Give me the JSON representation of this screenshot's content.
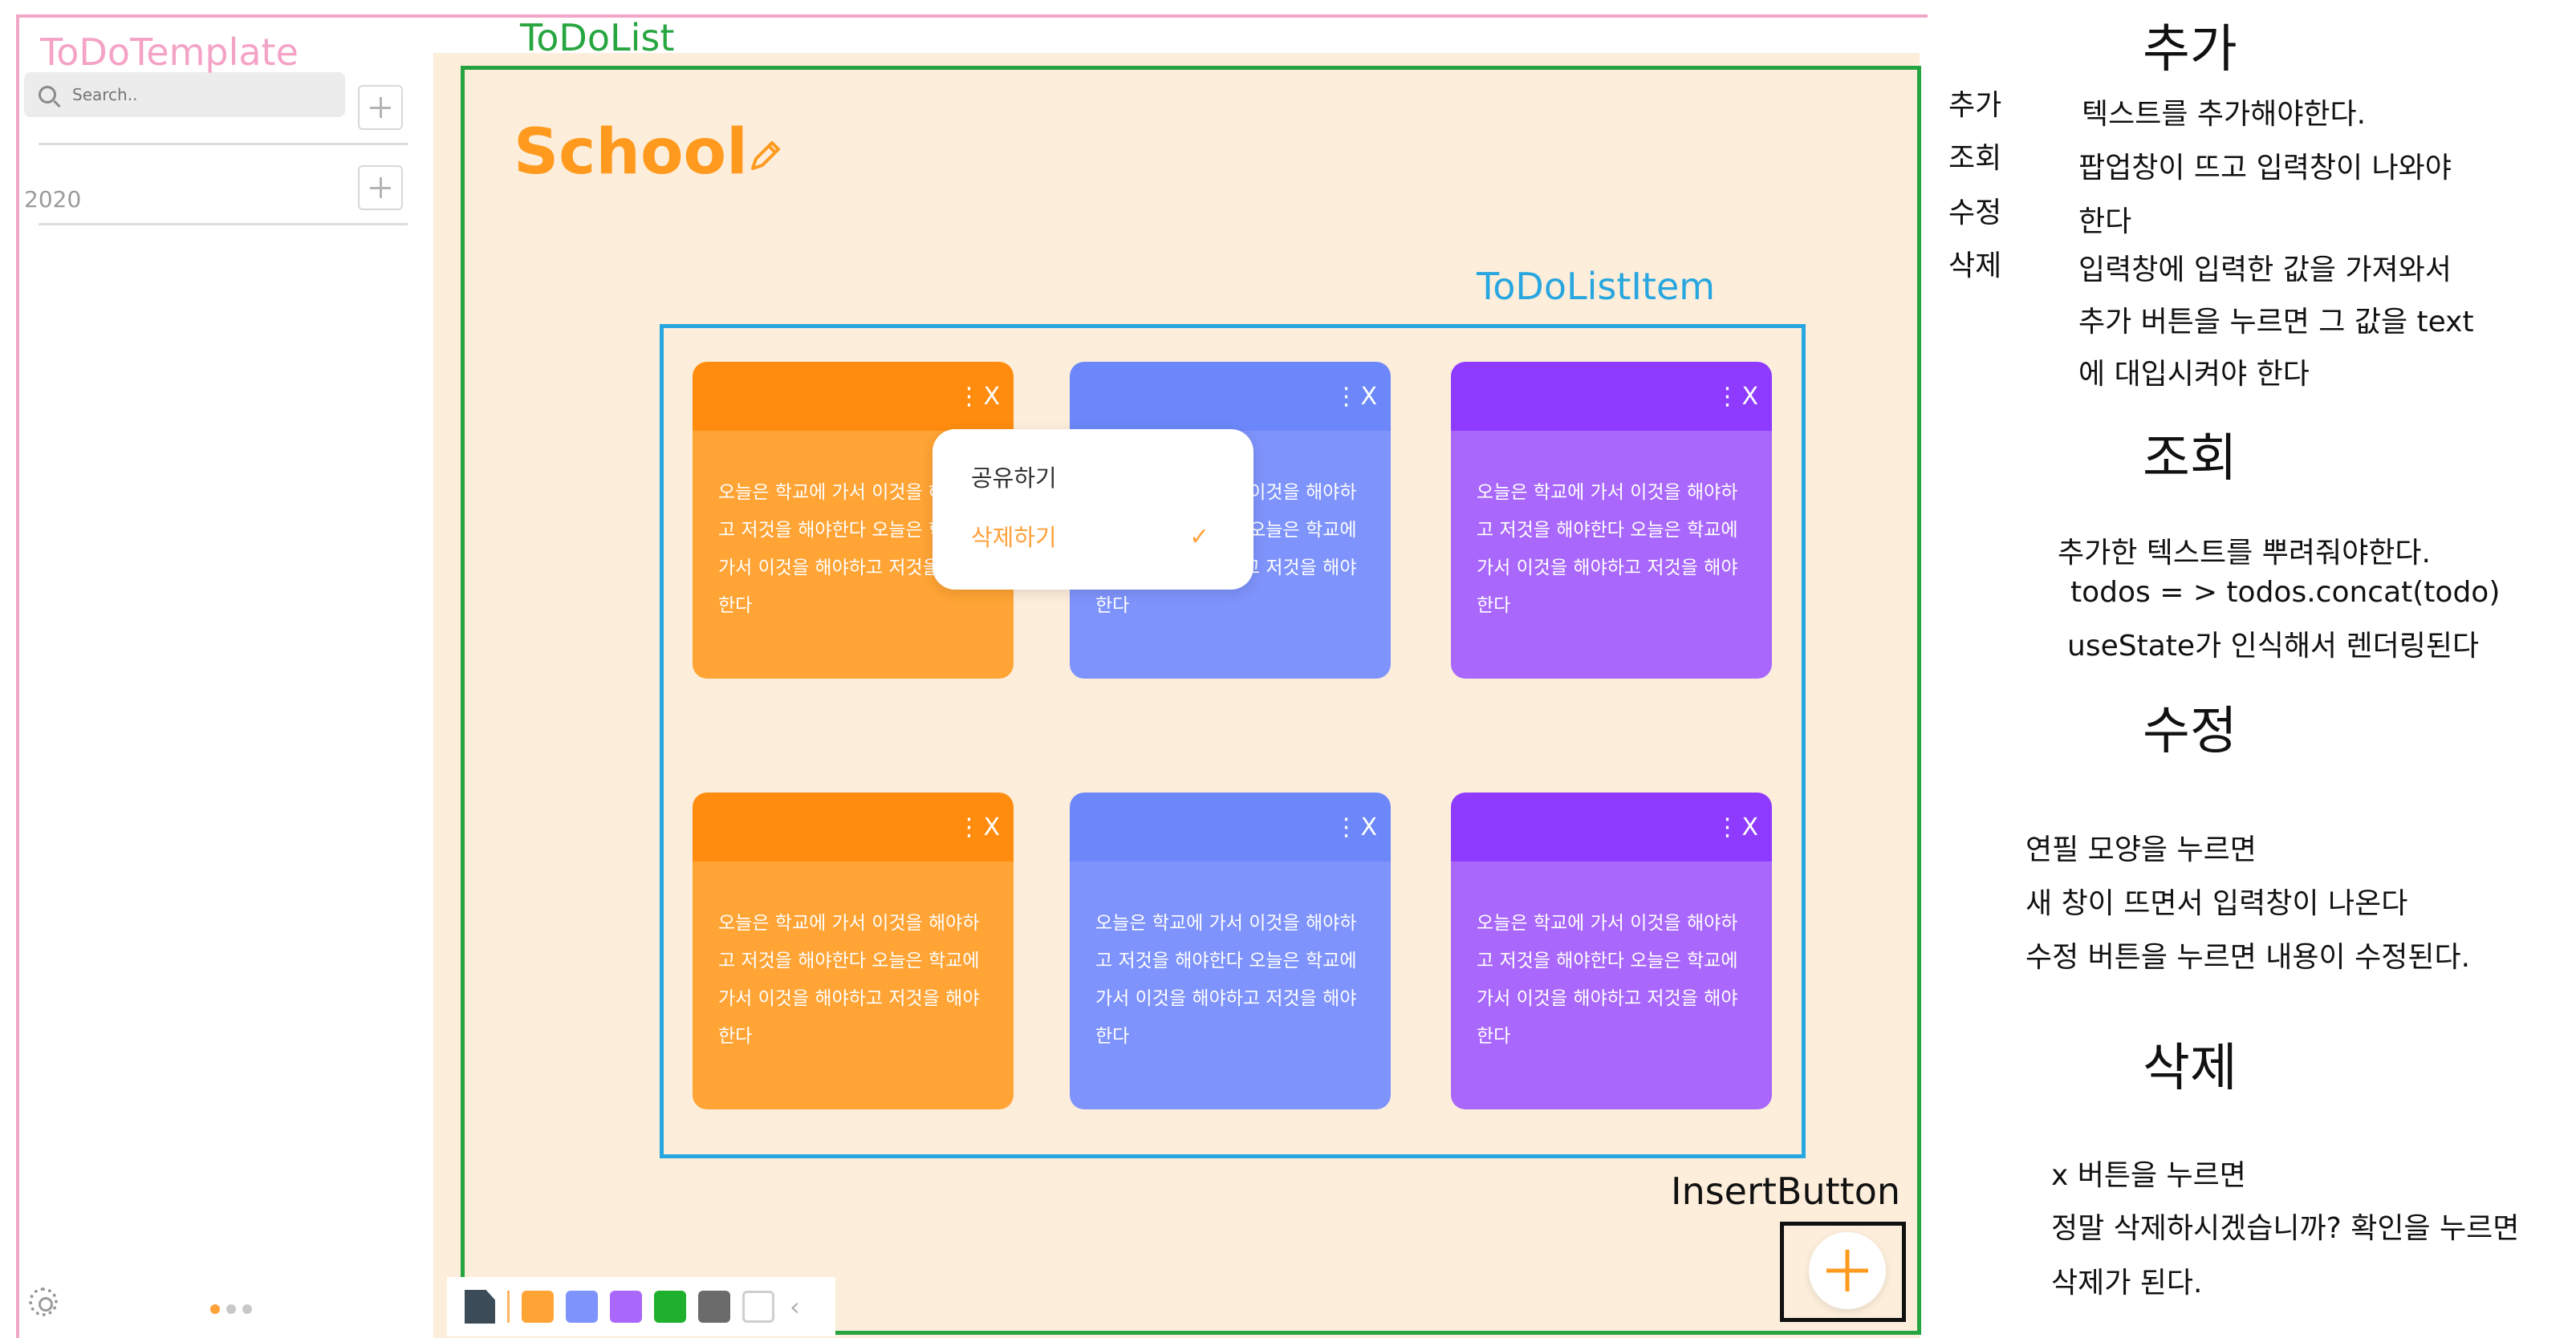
{
  "labels": {
    "todo_template": "ToDoTemplate",
    "todo_list": "ToDoList",
    "todo_list_item": "ToDoListItem",
    "insert_button": "InsertButton"
  },
  "sidebar": {
    "search_placeholder": "Search..",
    "year": "2020"
  },
  "main": {
    "title": "School",
    "card_text": "오늘은 학교에 가서 이것을 해야하고 저것을 해야한다 오늘은 학교에 가서 이것을 해야하고 저것을 해야한다",
    "card_menu": "⋮X"
  },
  "popup": {
    "share": "공유하기",
    "delete": "삭제하기",
    "check": "✓"
  },
  "colors": {
    "orange": "#ffa435",
    "blue": "#7e93fb",
    "purple": "#a968fb",
    "green": "#1fb12d",
    "gray": "#6b6b6b"
  },
  "notes": {
    "side": [
      "추가",
      "조회",
      "수정",
      "삭제"
    ],
    "add_heading": "추가",
    "add_lines": [
      "텍스트를 추가해야한다.",
      "팝업창이 뜨고 입력창이 나와야",
      "한다",
      "입력창에 입력한 값을 가져와서",
      "추가 버튼을 누르면 그 값을 text",
      "에 대입시켜야 한다"
    ],
    "read_heading": "조회",
    "read_lines": [
      "추가한 텍스트를 뿌려줘야한다.",
      "todos = > todos.concat(todo)",
      "useState가 인식해서 렌더링된다"
    ],
    "edit_heading": "수정",
    "edit_lines": [
      "연필 모양을 누르면",
      "새 창이 뜨면서 입력창이 나온다",
      "수정 버튼을 누르면 내용이 수정된다."
    ],
    "delete_heading": "삭제",
    "delete_lines": [
      "x 버튼을 누르면",
      "정말 삭제하시겠습니까? 확인을 누르면",
      "삭제가 된다."
    ]
  }
}
